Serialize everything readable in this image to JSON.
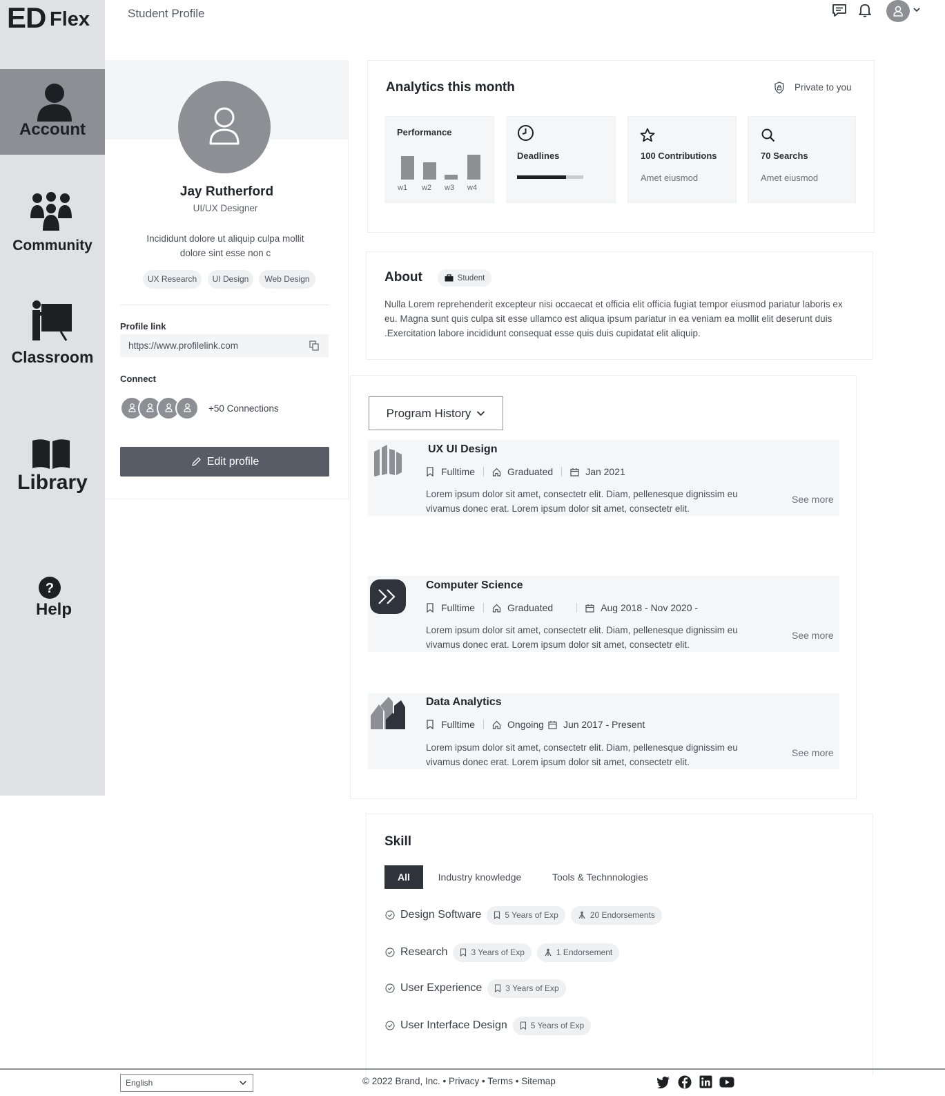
{
  "brand": {
    "logo_main": "ED",
    "logo_sub": "Flex"
  },
  "header": {
    "title": "Student Profile"
  },
  "nav": {
    "account": "Account",
    "community": "Community",
    "classroom": "Classroom",
    "library": "Library",
    "help": "Help"
  },
  "profile": {
    "name": "Jay Rutherford",
    "role": "UI/UX Designer",
    "bio_line1": "Incididunt dolore ut aliquip culpa  mollit",
    "bio_line2": "dolore sint esse non c",
    "tags": [
      "UX Research",
      "UI Design",
      "Web Design"
    ],
    "link_label": "Profile link",
    "link_value": "https://www.profilelink.com",
    "connect_label": "Connect",
    "connections": "+50 Connections",
    "edit_label": "Edit profile"
  },
  "analytics": {
    "title": "Analytics this month",
    "privacy": "Private to you",
    "performance": {
      "title": "Performance",
      "weeks": [
        "w1",
        "w2",
        "w3",
        "w4"
      ],
      "values": [
        0.9,
        0.65,
        0.18,
        0.95
      ]
    },
    "deadlines": {
      "title": "Deadlines",
      "progress": 0.74
    },
    "contributions": {
      "title": "100 Contributions",
      "sub": "Amet eiusmod"
    },
    "searches": {
      "title": "70 Searchs",
      "sub": "Amet eiusmod"
    }
  },
  "about": {
    "title": "About",
    "badge": "Student",
    "text": "Nulla Lorem reprehenderit excepteur nisi occaecat et officia elit officia fugiat tempor eiusmod pariatur laboris ex eu. Magna sunt quis culpa sit esse ullamco est aliqua ipsum pariatur in ea veniam ea mollit elit deserunt duis .Exercitation labore incididunt consequat esse quis duis cupidatat elit aliquip."
  },
  "programs": {
    "dropdown": "Program History",
    "items": [
      {
        "title": "UX UI Design",
        "type": "Fulltime",
        "status": "Graduated",
        "date": "Jan 2021",
        "desc": "Lorem ipsum dolor sit amet, consectetr  elit. Diam, pellenesque dignissim eu vivamus donec erat. Lorem ipsum dolor sit amet, consectetr  elit.",
        "more": "See more"
      },
      {
        "title": "Computer Science",
        "type": "Fulltime",
        "status": "Graduated",
        "date": "Aug 2018 - Nov 2020 -",
        "desc": "Lorem ipsum dolor sit amet, consectetr  elit. Diam, pellenesque dignissim eu vivamus donec erat. Lorem ipsum dolor sit amet, consectetr  elit.",
        "more": "See more"
      },
      {
        "title": "Data Analytics",
        "type": "Fulltime",
        "status": "Ongoing",
        "date": "Jun 2017 -  Present",
        "desc": "Lorem ipsum dolor sit amet, consectetr  elit. Diam, pellenesque dignissim eu vivamus donec erat. Lorem ipsum dolor sit amet, consectetr  elit.",
        "more": "See more"
      }
    ]
  },
  "skills": {
    "title": "Skill",
    "tabs": [
      "All",
      "Industry knowledge",
      "Tools & Technnologies"
    ],
    "items": [
      {
        "name": "Design Software",
        "exp": "5 Years of Exp",
        "endorse": "20 Endorsements"
      },
      {
        "name": "Research",
        "exp": "3 Years of Exp",
        "endorse": "1 Endorsement"
      },
      {
        "name": "User Experience",
        "exp": "3 Years of Exp"
      },
      {
        "name": "User Interface Design",
        "exp": "5 Years of Exp"
      }
    ]
  },
  "footer": {
    "language": "English",
    "copyright": "© 2022 Brand, Inc. • Privacy • Terms • Sitemap",
    "social": [
      "twitter-icon",
      "facebook-icon",
      "linkedin-icon",
      "youtube-icon"
    ]
  },
  "colors": {
    "sidebar": "#e0e1e4",
    "active": "#8e8f94",
    "button": "#575c67",
    "dark": "#2f333b"
  }
}
